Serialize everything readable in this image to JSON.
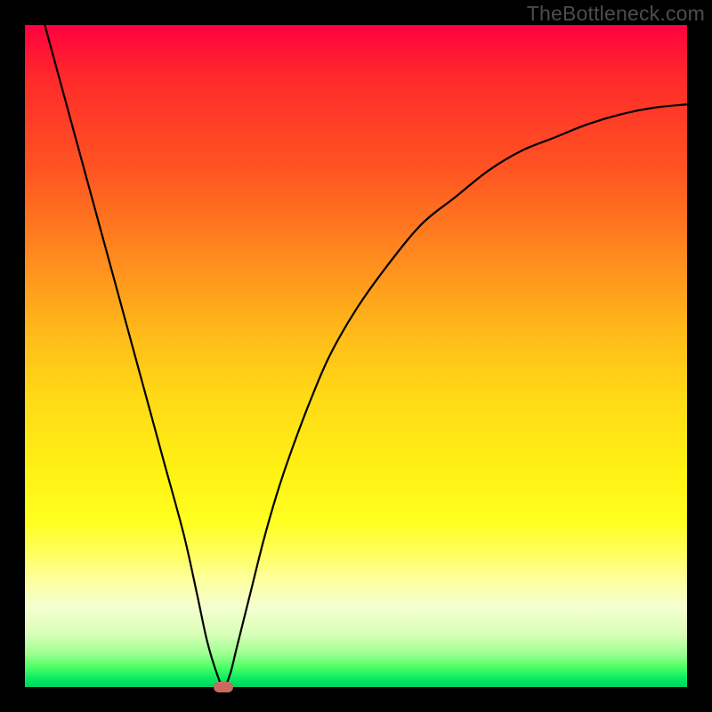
{
  "watermark": "TheBottleneck.com",
  "chart_data": {
    "type": "line",
    "title": "",
    "xlabel": "",
    "ylabel": "",
    "xlim": [
      0,
      100
    ],
    "ylim": [
      0,
      100
    ],
    "grid": false,
    "legend": false,
    "series": [
      {
        "name": "curve",
        "x": [
          3,
          6,
          9,
          12,
          15,
          18,
          21,
          24,
          26,
          27.5,
          29,
          30,
          31,
          32,
          34,
          36,
          38,
          40,
          43,
          46,
          50,
          55,
          60,
          65,
          70,
          75,
          80,
          85,
          90,
          95,
          100
        ],
        "values": [
          100,
          89,
          78,
          67,
          56,
          45,
          34,
          23,
          14,
          7,
          2,
          0,
          2,
          6,
          14,
          22,
          29,
          35,
          43,
          50,
          57,
          64,
          70,
          74,
          78,
          81,
          83,
          85,
          86.5,
          87.5,
          88
        ]
      }
    ],
    "marker": {
      "x": 30,
      "y": 0
    }
  }
}
